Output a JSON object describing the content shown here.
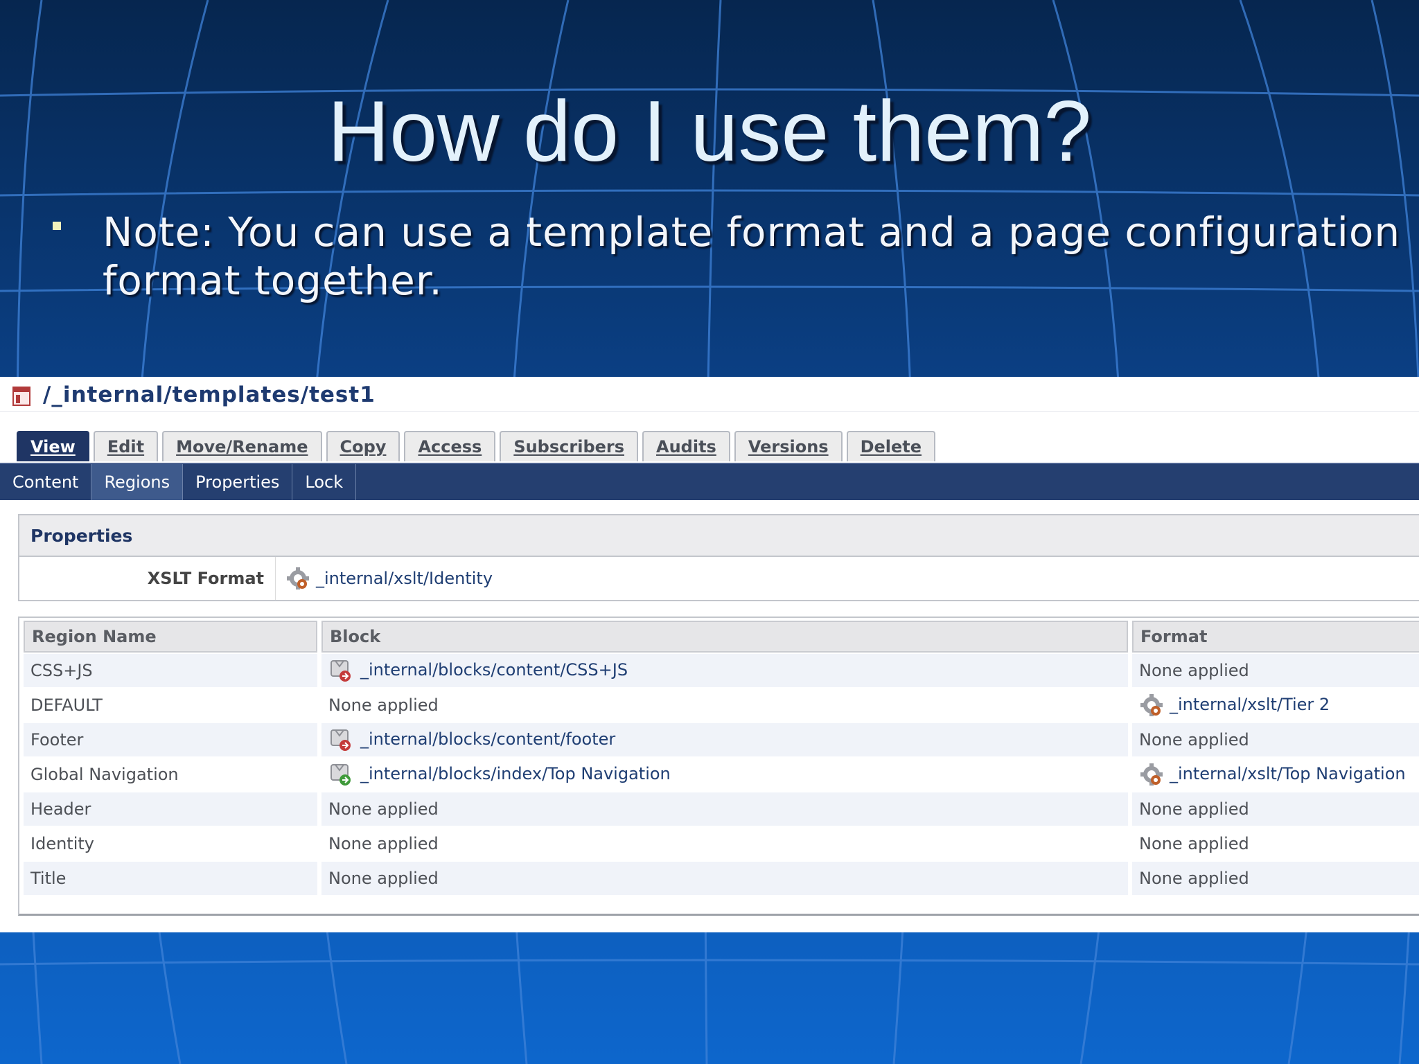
{
  "slide": {
    "title": "How do I use them?",
    "note": "Note: You can use a template format and a page configuration format together."
  },
  "asset_path": "/_internal/templates/test1",
  "tabs": [
    {
      "label": "View",
      "active": true
    },
    {
      "label": "Edit"
    },
    {
      "label": "Move/Rename"
    },
    {
      "label": "Copy"
    },
    {
      "label": "Access"
    },
    {
      "label": "Subscribers"
    },
    {
      "label": "Audits"
    },
    {
      "label": "Versions"
    },
    {
      "label": "Delete"
    }
  ],
  "subnav": [
    {
      "label": "Content"
    },
    {
      "label": "Regions",
      "active": true
    },
    {
      "label": "Properties"
    },
    {
      "label": "Lock"
    }
  ],
  "properties": {
    "heading": "Properties",
    "xslt_label": "XSLT Format",
    "xslt_value": "_internal/xslt/Identity",
    "xslt_icon": "format-gear-icon"
  },
  "regions_table": {
    "headers": [
      "Region Name",
      "Block",
      "Format"
    ],
    "rows": [
      {
        "region": "CSS+JS",
        "block": "_internal/blocks/content/CSS+JS",
        "block_icon": "block-red-icon",
        "format": "None applied"
      },
      {
        "region": "DEFAULT",
        "block": "None applied",
        "format": "_internal/xslt/Tier 2",
        "format_icon": "format-gear-icon"
      },
      {
        "region": "Footer",
        "block": "_internal/blocks/content/footer",
        "block_icon": "block-red-icon",
        "format": "None applied"
      },
      {
        "region": "Global Navigation",
        "block": "_internal/blocks/index/Top Navigation",
        "block_icon": "block-green-icon",
        "format": "_internal/xslt/Top Navigation",
        "format_icon": "format-gear-icon"
      },
      {
        "region": "Header",
        "block": "None applied",
        "format": "None applied"
      },
      {
        "region": "Identity",
        "block": "None applied",
        "format": "None applied"
      },
      {
        "region": "Title",
        "block": "None applied",
        "format": "None applied"
      }
    ]
  },
  "colors": {
    "slide_bg": "#0a3a78",
    "title_text": "#e3f1fb",
    "nav_bar": "#253f70",
    "link": "#1f3e73"
  }
}
